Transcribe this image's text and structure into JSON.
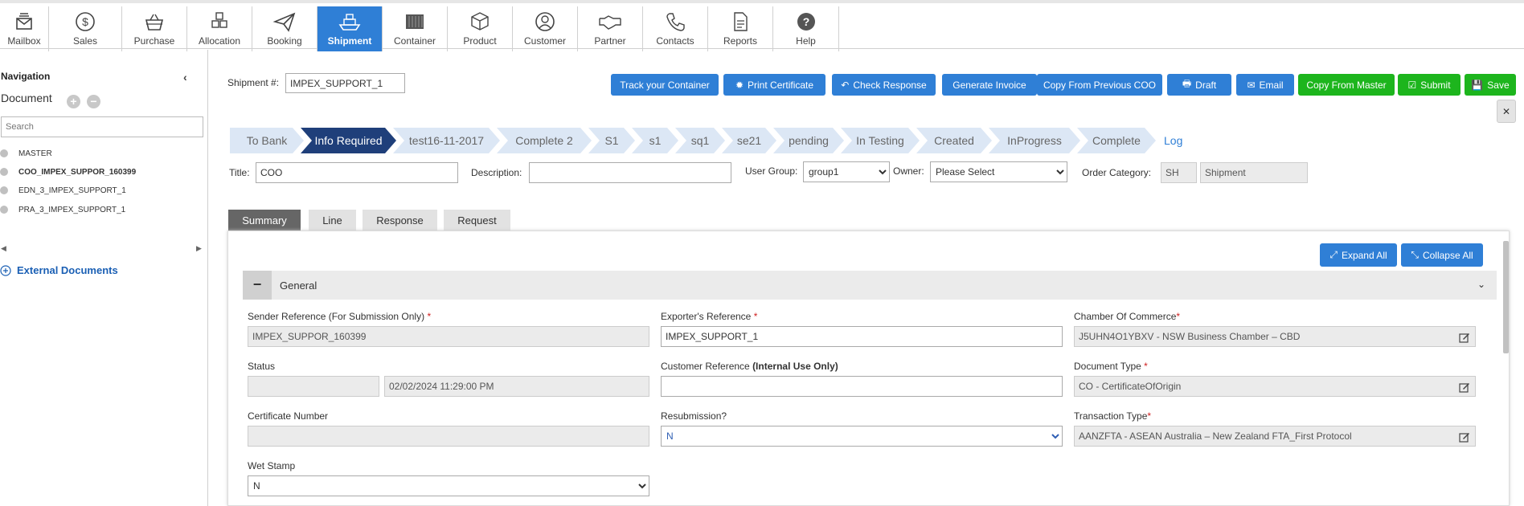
{
  "topnav": {
    "items": [
      {
        "label": "Mailbox",
        "icon": "mailbox-icon"
      },
      {
        "label": "Sales",
        "icon": "dollar-icon"
      },
      {
        "label": "Purchase",
        "icon": "basket-icon"
      },
      {
        "label": "Allocation",
        "icon": "boxes-icon"
      },
      {
        "label": "Booking",
        "icon": "paper-plane-icon"
      },
      {
        "label": "Shipment",
        "icon": "ship-icon"
      },
      {
        "label": "Container",
        "icon": "container-icon"
      },
      {
        "label": "Product",
        "icon": "product-box-icon"
      },
      {
        "label": "Customer",
        "icon": "customer-icon"
      },
      {
        "label": "Partner",
        "icon": "handshake-icon"
      },
      {
        "label": "Contacts",
        "icon": "phone-icon"
      },
      {
        "label": "Reports",
        "icon": "report-icon"
      },
      {
        "label": "Help",
        "icon": "help-icon"
      }
    ],
    "active": "Shipment"
  },
  "sidebar": {
    "title": "Navigation",
    "document_label": "Document",
    "search_placeholder": "Search",
    "items": [
      {
        "label": "MASTER",
        "bold": false
      },
      {
        "label": "COO_IMPEX_SUPPOR_160399",
        "bold": true
      },
      {
        "label": "EDN_3_IMPEX_SUPPORT_1",
        "bold": false
      },
      {
        "label": "PRA_3_IMPEX_SUPPORT_1",
        "bold": false
      }
    ],
    "external_documents": "External Documents"
  },
  "header": {
    "shipment_label": "Shipment #:",
    "shipment_value": "IMPEX_SUPPORT_1"
  },
  "actions": {
    "track": "Track your Container",
    "print": "Print Certificate",
    "check": "Check Response",
    "invoice": "Generate Invoice",
    "copy_prev": "Copy From Previous COO",
    "draft": "Draft",
    "email": "Email",
    "copy_master": "Copy From Master",
    "submit": "Submit",
    "save": "Save",
    "exit": "Exit"
  },
  "steps": {
    "items": [
      "To Bank",
      "Info Required",
      "test16-11-2017",
      "Complete 2",
      "S1",
      "s1",
      "sq1",
      "se21",
      "pending",
      "In Testing",
      "Created",
      "InProgress",
      "Complete"
    ],
    "active": "Info Required",
    "log": "Log"
  },
  "meta": {
    "title_label": "Title:",
    "title_value": "COO",
    "description_label": "Description:",
    "description_value": "",
    "user_group_label": "User Group:",
    "user_group_value": "group1",
    "owner_label": "Owner:",
    "owner_value": "Please Select",
    "order_category_label": "Order Category:",
    "order_category_code": "SH",
    "order_category_value": "Shipment"
  },
  "tabs": [
    "Summary",
    "Line",
    "Response",
    "Request"
  ],
  "panel": {
    "expand_all": "Expand All",
    "collapse_all": "Collapse All",
    "section_title": "General",
    "collapse_symbol": "−"
  },
  "form": {
    "sender_ref_label": "Sender Reference (For Submission Only)",
    "sender_ref_value": "IMPEX_SUPPOR_160399",
    "exporter_ref_label": "Exporter's Reference",
    "exporter_ref_value": "IMPEX_SUPPORT_1",
    "chamber_label": "Chamber Of Commerce",
    "chamber_value": "J5UHN4O1YBXV - NSW Business Chamber – CBD",
    "status_label": "Status",
    "status_value": "",
    "status_date": "02/02/2024 11:29:00 PM",
    "customer_ref_label": "Customer Reference",
    "customer_ref_suffix": "(Internal Use Only)",
    "customer_ref_value": "",
    "doc_type_label": "Document Type",
    "doc_type_value": "CO - CertificateOfOrigin",
    "cert_number_label": "Certificate Number",
    "cert_number_value": "",
    "resubmission_label": "Resubmission?",
    "resubmission_value": "N",
    "transaction_type_label": "Transaction Type",
    "transaction_type_value": "AANZFTA - ASEAN Australia – New Zealand FTA_First Protocol",
    "wet_stamp_label": "Wet Stamp",
    "wet_stamp_value": "N",
    "required_mark": "*"
  },
  "colors": {
    "accent_blue": "#2f7fd6",
    "green": "#1db51d",
    "active_step": "#1f3f7a",
    "step_bg": "#dce7f5"
  }
}
